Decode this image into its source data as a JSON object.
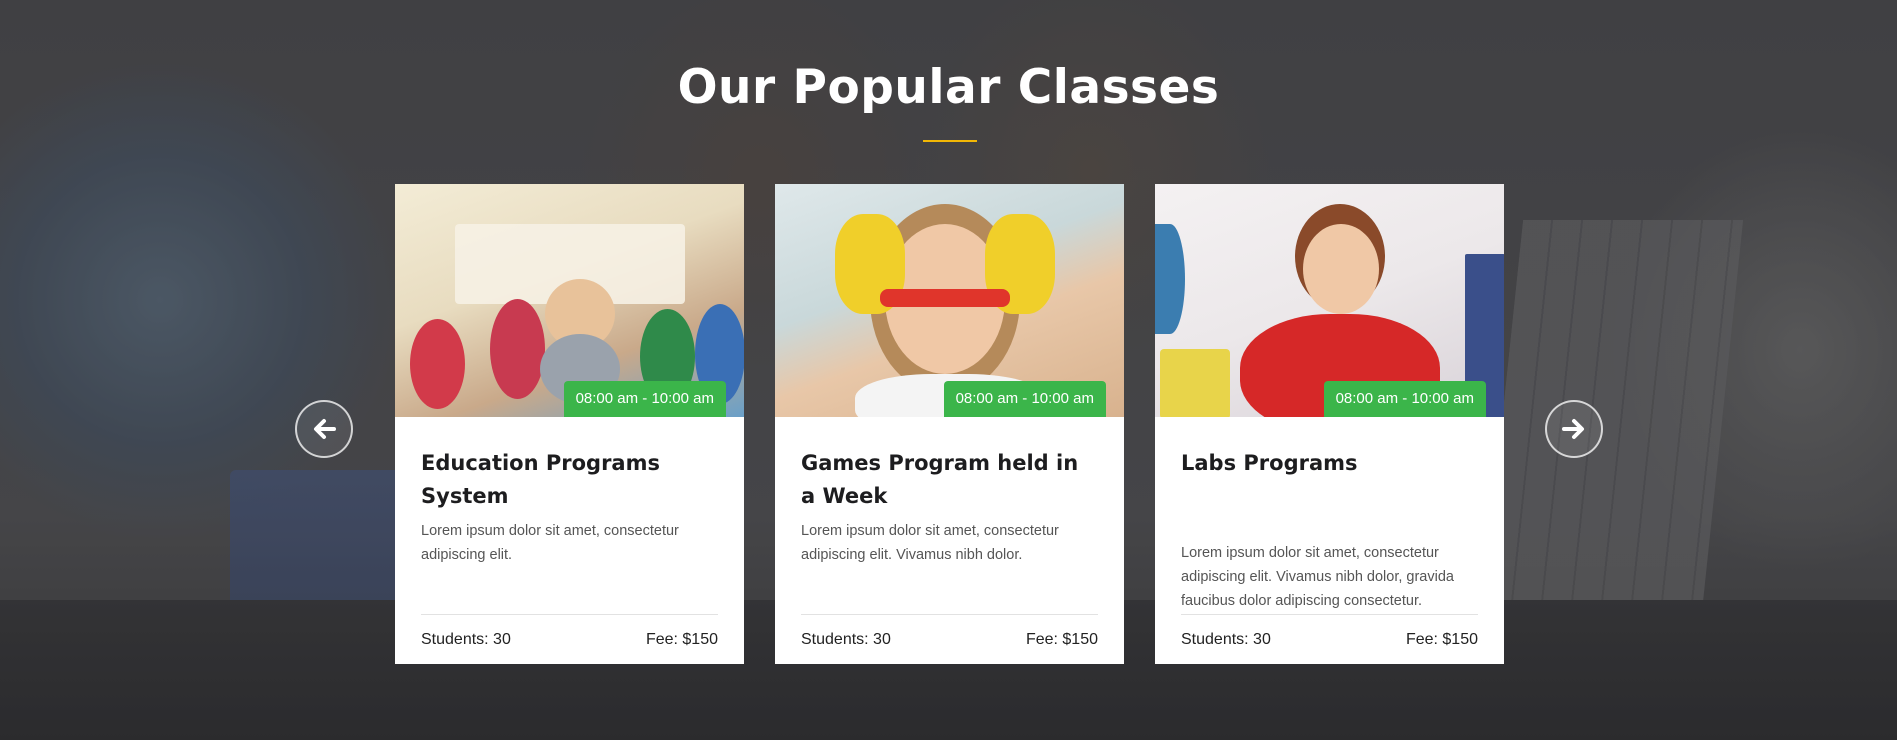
{
  "section": {
    "title": "Our Popular Classes",
    "accent_color": "#f2b705"
  },
  "badge_color": "#3bb54a",
  "classes": [
    {
      "time": "08:00 am - 10:00 am",
      "title": "Education Programs System",
      "description": "Lorem ipsum dolor sit amet, consectetur adipiscing elit.",
      "students": "Students: 30",
      "fee": "Fee: $150",
      "image": "classroom-teacher-children-photo"
    },
    {
      "time": "08:00 am - 10:00 am",
      "title": "Games Program held in a Week",
      "description": "Lorem ipsum dolor sit amet, consectetur adipiscing elit. Vivamus nibh dolor.",
      "students": "Students: 30",
      "fee": "Fee: $150",
      "image": "girl-painted-hands-photo"
    },
    {
      "time": "08:00 am - 10:00 am",
      "title": "Labs Programs",
      "description": "Lorem ipsum dolor sit amet, consectetur adipiscing elit. Vivamus nibh dolor, gravida faucibus dolor adipiscing consectetur.",
      "students": "Students: 30",
      "fee": "Fee: $150",
      "image": "boy-drawing-photo"
    }
  ],
  "navigation": {
    "prev_icon": "arrow-left-icon",
    "next_icon": "arrow-right-icon"
  }
}
